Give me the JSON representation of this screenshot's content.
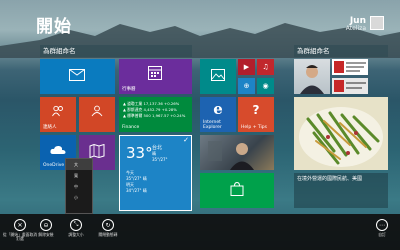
{
  "start": {
    "title": "開始"
  },
  "user": {
    "name": "Jun",
    "subtitle": "Ateliza"
  },
  "groups": {
    "left": "為群組命名",
    "right": "為群組命名"
  },
  "tiles": {
    "calendar": "行事曆",
    "people": "連絡人",
    "finance": "Finance",
    "onedrive": "OneDrive",
    "ie": "Internet Explorer",
    "help": "Help + Tips",
    "store": "市集"
  },
  "finance": {
    "rows": [
      "▲ 道瓊工業 17,137.36 +0.26%",
      "▲ 那斯達克 4,452.79 +0.28%",
      "▲ 標準普爾 500 1,967.57 +0.24%"
    ]
  },
  "weather": {
    "temperature": "33°",
    "city": "台北",
    "condition": "晴",
    "range": "35°/27°",
    "lines": [
      "今天",
      "35°/27° 晴",
      "明天",
      "34°/27° 晴"
    ]
  },
  "news": {
    "headline": "在境外營運的國際民航、美國"
  },
  "size_menu": {
    "options": [
      "大",
      "寬",
      "中",
      "小"
    ],
    "selected": "大"
  },
  "appbar": {
    "buttons": [
      {
        "label": "從「開始」畫面取消釘選",
        "icon": "unpin-icon"
      },
      {
        "label": "解除安裝",
        "icon": "uninstall-icon"
      },
      {
        "label": "調整大小",
        "icon": "resize-icon"
      },
      {
        "label": "關閉動態磚",
        "icon": "live-tile-off-icon"
      }
    ],
    "customize": "自訂"
  },
  "colors": {
    "mail": "#0a7bbf",
    "calendar": "#6b2d9c",
    "photos": "#008a8a",
    "people": "#d24726",
    "finance": "#008a3d",
    "weather": "#1d84c6",
    "onedrive": "#0a62b0",
    "music": "#c1272d",
    "video": "#b21e2c",
    "ie": "#1d63b1",
    "help": "#d74b2c",
    "store": "#00a14b",
    "health": "#c52a48",
    "purple_tile": "#6a2f8f"
  }
}
